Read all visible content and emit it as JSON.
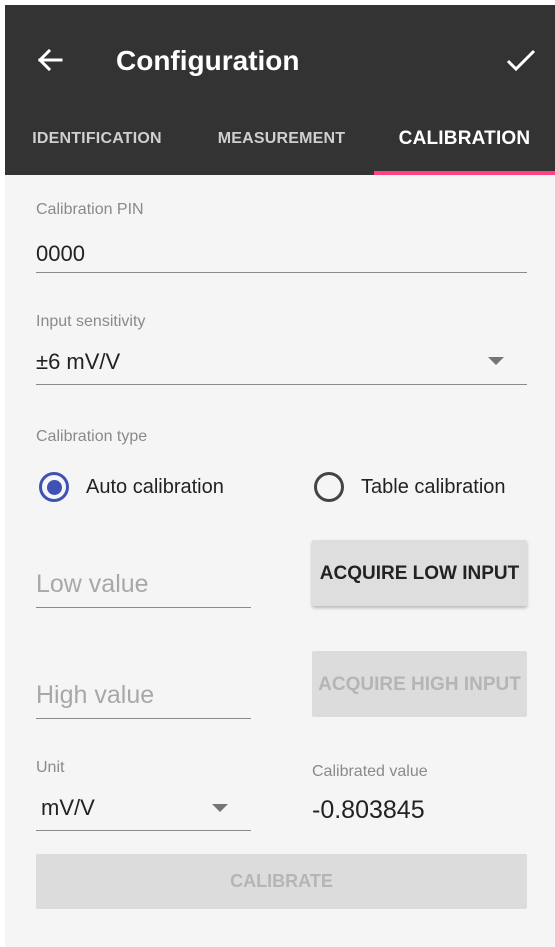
{
  "appbar": {
    "title": "Configuration",
    "back_icon": "arrow-back-icon",
    "done_icon": "checkmark-icon"
  },
  "tabs": [
    {
      "label": "IDENTIFICATION",
      "active": false
    },
    {
      "label": "MEASUREMENT",
      "active": false
    },
    {
      "label": "CALIBRATION",
      "active": true
    }
  ],
  "form": {
    "pin": {
      "label": "Calibration PIN",
      "value": "0000"
    },
    "sensitivity": {
      "label": "Input sensitivity",
      "value": "±6 mV/V"
    },
    "calibration_type": {
      "label": "Calibration type",
      "options": [
        {
          "label": "Auto calibration",
          "selected": true
        },
        {
          "label": "Table calibration",
          "selected": false
        }
      ]
    },
    "low": {
      "placeholder": "Low value",
      "button": "ACQUIRE LOW INPUT"
    },
    "high": {
      "placeholder": "High value",
      "button": "ACQUIRE HIGH INPUT"
    },
    "unit": {
      "label": "Unit",
      "value": "mV/V"
    },
    "calibrated": {
      "label": "Calibrated value",
      "value": "-0.803845"
    },
    "calibrate_button": "CALIBRATE"
  },
  "colors": {
    "appbar": "#333333",
    "accent": "#ff4081",
    "radio": "#3f51b5",
    "background": "#f5f5f5"
  }
}
